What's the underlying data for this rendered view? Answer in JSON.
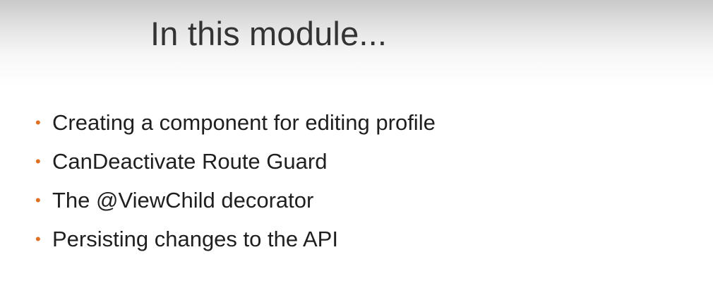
{
  "slide": {
    "title": "In this module...",
    "bullet_symbol": "•",
    "bullet_color": "#e07020",
    "bullets": [
      "Creating a component for editing profile",
      "CanDeactivate Route Guard",
      "The @ViewChild decorator",
      "Persisting changes to the API"
    ]
  }
}
